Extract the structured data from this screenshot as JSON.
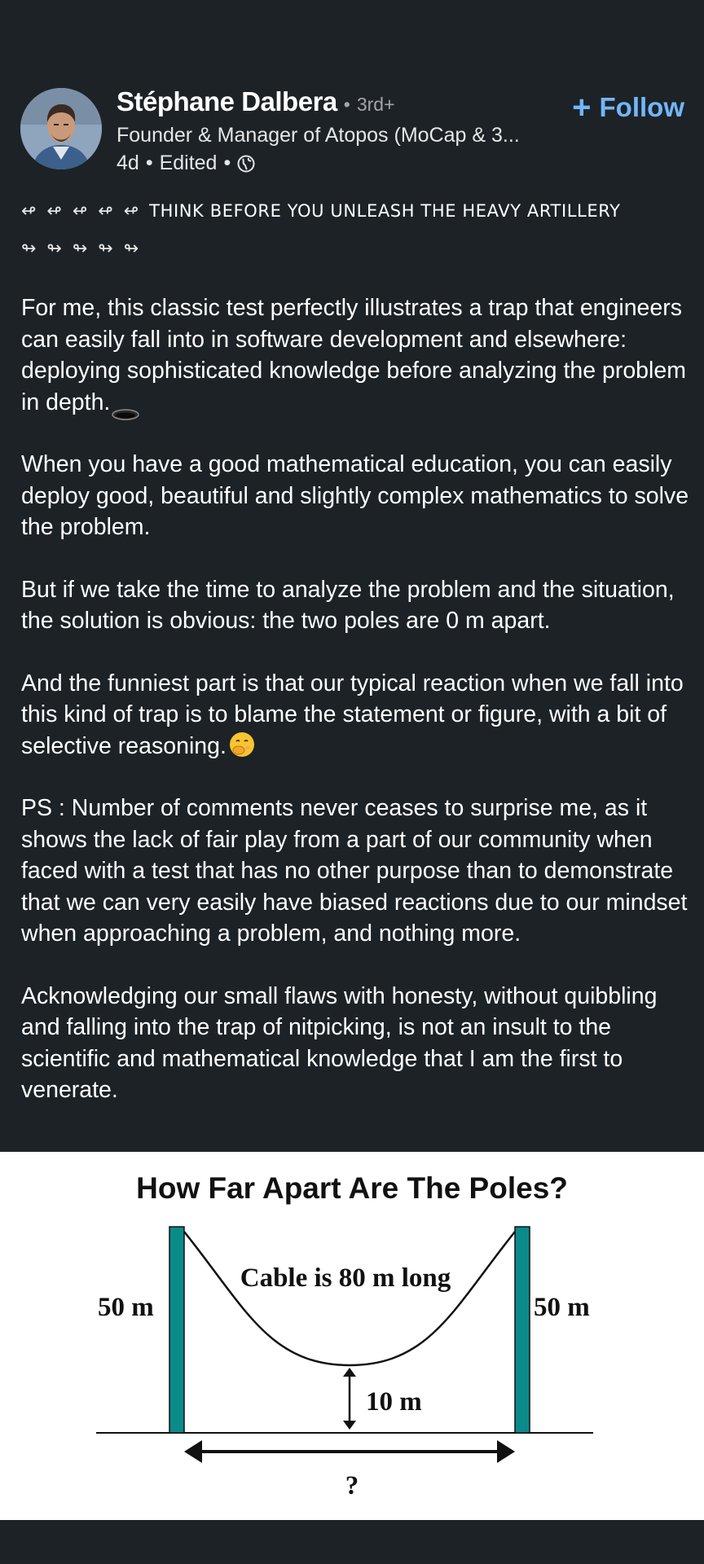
{
  "author": {
    "name": "Stéphane Dalbera",
    "degree": "3rd+",
    "headline": "Founder & Manager of Atopos (MoCap & 3...",
    "timestamp": "4d",
    "edited": "Edited",
    "separator": "•",
    "visibility_icon": "globe-icon",
    "avatar_icon": "avatar"
  },
  "follow": {
    "plus": "+",
    "label": "Follow",
    "color": "#71b7fb"
  },
  "post": {
    "arrows_left": "↫ ↫ ↫ ↫ ↫",
    "title": "THINK BEFORE YOU UNLEASH THE HEAVY ARTILLERY",
    "arrows_right": "↬ ↬ ↬ ↬ ↬",
    "paragraphs": [
      "For me, this classic test perfectly illustrates a trap that engineers can easily fall into in software development and elsewhere: deploying sophisticated knowledge before analyzing the problem in depth.",
      "When you have a good mathematical education, you can easily deploy good, beautiful and slightly complex mathematics to solve the problem.",
      "But if we take the time to analyze the problem and the situation, the solution is obvious: the two poles are 0 m apart.",
      "And the funniest part is that our typical reaction when we fall into this kind of trap is to blame the statement or figure, with a bit of selective reasoning.",
      "PS :  Number of comments never ceases to surprise me, as it shows the lack of fair play from a part of our community when faced with a test that has no other purpose than to demonstrate that we can very easily have biased reactions due to our mindset when approaching a problem, and nothing more.",
      "Acknowledging our small flaws with honesty, without quibbling and falling into the trap of nitpicking, is not an insult to the scientific and mathematical knowledge that I am the first to venerate."
    ],
    "inline_icons": {
      "p0": "hole-icon",
      "p3": "face-with-hand-over-mouth-icon"
    }
  },
  "figure": {
    "title": "How Far Apart Are The Poles?",
    "cable_label": "Cable is 80 m long",
    "left_pole_label": "50 m",
    "right_pole_label": "50 m",
    "sag_label": "10 m",
    "distance_label": "?",
    "pole_color": "#0b8a8a"
  },
  "colors": {
    "background": "#1d2226",
    "text": "#ffffff",
    "muted": "#a3a6a9",
    "accent": "#71b7fb"
  }
}
